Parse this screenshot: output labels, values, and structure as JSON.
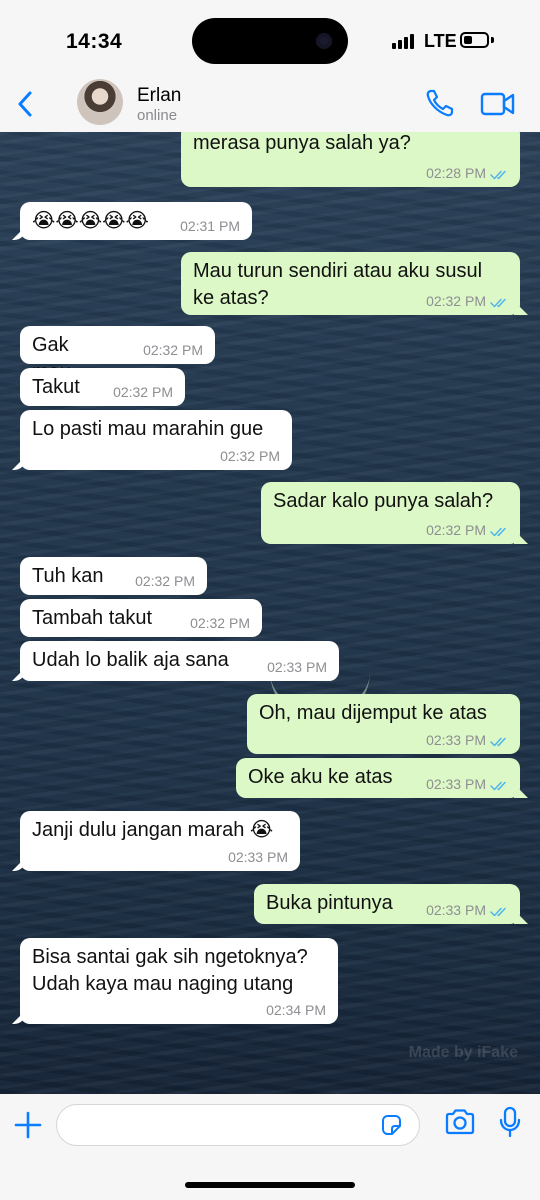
{
  "status": {
    "time": "14:34",
    "carrier": "LTE",
    "battery_level": 0.4
  },
  "contact": {
    "name": "Erlan",
    "status": "online"
  },
  "messages": [
    {
      "dir": "out",
      "text": "merasa punya salah ya?",
      "time": "02:28 PM",
      "read": true
    },
    {
      "dir": "in",
      "text": "😭😭😭😭😭",
      "time": "02:31 PM"
    },
    {
      "dir": "out",
      "text": "Mau turun sendiri atau aku susul ke atas?",
      "time": "02:32 PM",
      "read": true
    },
    {
      "dir": "in",
      "text": "Gak mau",
      "time": "02:32 PM"
    },
    {
      "dir": "in",
      "text": "Takut",
      "time": "02:32 PM"
    },
    {
      "dir": "in",
      "text": "Lo pasti mau marahin gue",
      "time": "02:32 PM"
    },
    {
      "dir": "out",
      "text": "Sadar kalo punya salah?",
      "time": "02:32 PM",
      "read": true
    },
    {
      "dir": "in",
      "text": "Tuh kan",
      "time": "02:32 PM"
    },
    {
      "dir": "in",
      "text": "Tambah takut",
      "time": "02:32 PM"
    },
    {
      "dir": "in",
      "text": "Udah lo balik aja sana",
      "time": "02:33 PM"
    },
    {
      "dir": "out",
      "text": "Oh, mau dijemput ke atas",
      "time": "02:33 PM",
      "read": true
    },
    {
      "dir": "out",
      "text": "Oke aku ke atas",
      "time": "02:33 PM",
      "read": true
    },
    {
      "dir": "in",
      "text": "Janji dulu jangan marah 😭",
      "time": "02:33 PM"
    },
    {
      "dir": "out",
      "text": "Buka pintunya",
      "time": "02:33 PM",
      "read": true
    },
    {
      "dir": "in",
      "text": "Bisa santai gak sih ngetoknya? Udah kaya mau naging utang",
      "time": "02:34 PM"
    }
  ],
  "watermark": "Made by iFake",
  "composer": {
    "placeholder": ""
  },
  "colors": {
    "accent": "#0a7cff",
    "outgoing_bubble": "#dcf8c6",
    "incoming_bubble": "#ffffff",
    "read_ticks": "#4fb6ec"
  },
  "icons": [
    "back-chevron-icon",
    "phone-icon",
    "video-camera-icon",
    "plus-icon",
    "sticker-icon",
    "camera-icon",
    "microphone-icon"
  ]
}
